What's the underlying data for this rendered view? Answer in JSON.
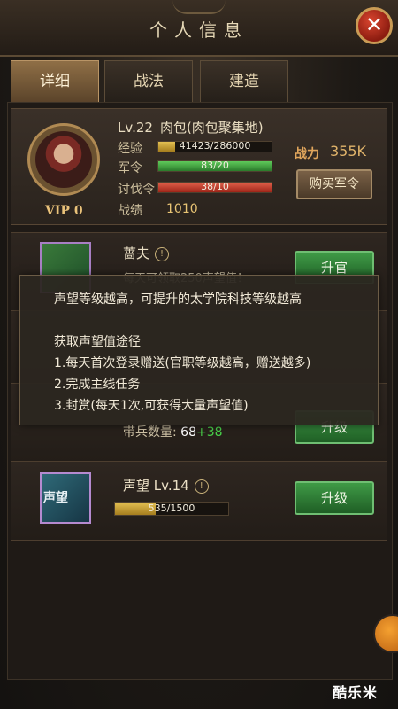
{
  "header": {
    "title": "个人信息"
  },
  "tabs": [
    {
      "label": "详细",
      "active": true
    },
    {
      "label": "战法",
      "active": false
    },
    {
      "label": "建造",
      "active": false
    }
  ],
  "profile": {
    "level": "Lv.22",
    "name": "肉包(肉包聚集地)",
    "vip": "VIP 0",
    "exp_label": "经验",
    "exp_value": "41423/286000",
    "exp_ratio": 0.145,
    "order_label": "军令",
    "order_value": "83/20",
    "order_ratio": 1.0,
    "attack_label": "讨伐令",
    "attack_value": "38/10",
    "attack_ratio": 1.0,
    "battle_label": "战绩",
    "battle_value": "1010",
    "power_label": "战力",
    "power_value": "355K",
    "buy_button": "购买军令"
  },
  "cards": [
    {
      "title": "蔷夫",
      "desc": "每天可领取250声望值！",
      "button": "升官"
    },
    {
      "desc_prefix": "带兵数量:",
      "troop_value": "68",
      "troop_plus": "+38",
      "button": "升级"
    },
    {
      "title": "声望 Lv.14",
      "progress": "535/1500",
      "progress_ratio": 0.357,
      "button": "升级",
      "icon_text": "声望"
    }
  ],
  "tooltip": {
    "line1": "声望等级越高，可提升的太学院科技等级越高",
    "line2": "获取声望值途径",
    "line3": "1.每天首次登录赠送(官职等级越高，赠送越多)",
    "line4": "2.完成主线任务",
    "line5": "3.封赏(每天1次,可获得大量声望值)"
  },
  "watermark": "酷乐米",
  "colors": {
    "accent": "#e0b36a",
    "exp": "#c9a235",
    "order": "#3fa83f",
    "attack": "#c23a2a",
    "button_green": "#3f9a46"
  }
}
